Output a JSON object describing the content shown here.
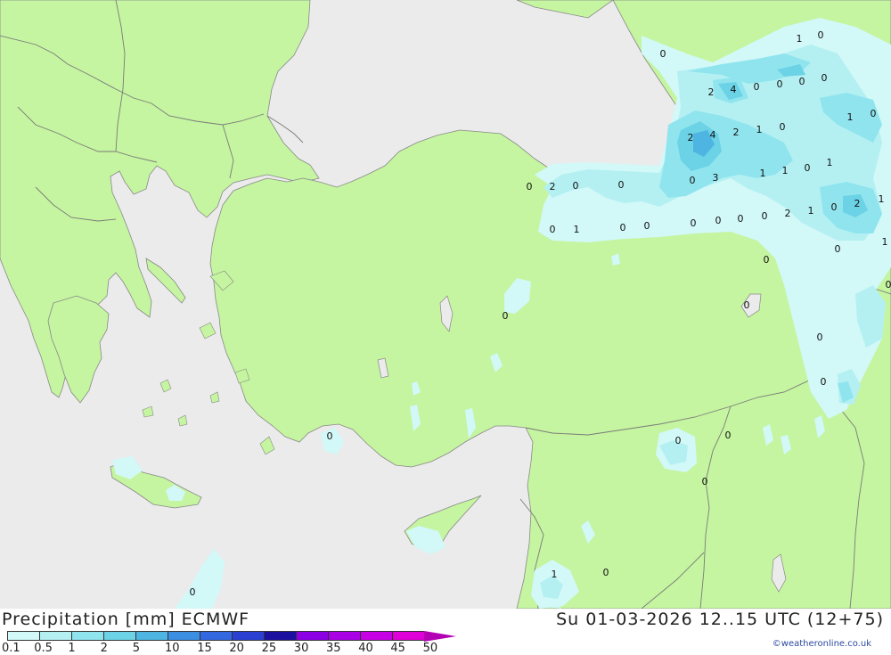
{
  "title": "Precipitation [mm] ECMWF",
  "datetime": "Su 01-03-2026 12..15 UTC (12+75)",
  "credit": "©weatheronline.co.uk",
  "colors": {
    "sea": "#ebebeb",
    "land": "#c5f5a0",
    "border": "#7a7a7a",
    "coast": "#888888"
  },
  "legend": {
    "ticks": [
      "0.1",
      "0.5",
      "1",
      "2",
      "5",
      "10",
      "15",
      "20",
      "25",
      "30",
      "35",
      "40",
      "45",
      "50"
    ],
    "colors": [
      "#d2f8f8",
      "#b4f0f2",
      "#90e4ee",
      "#6cd2e6",
      "#4eb4e2",
      "#3c8ee2",
      "#3468e0",
      "#2a40d2",
      "#1c10a0",
      "#8c00e6",
      "#aa00e6",
      "#c800e6",
      "#e000d8",
      "#b400b4"
    ]
  },
  "precip_values": [
    {
      "t": "1"
    },
    {
      "t": "0"
    },
    {
      "t": "0"
    },
    {
      "t": "2"
    },
    {
      "t": "4"
    },
    {
      "t": "0"
    },
    {
      "t": "0"
    },
    {
      "t": "0"
    },
    {
      "t": "0"
    },
    {
      "t": "1"
    },
    {
      "t": "0"
    },
    {
      "t": "2"
    },
    {
      "t": "4"
    },
    {
      "t": "2"
    },
    {
      "t": "1"
    },
    {
      "t": "0"
    },
    {
      "t": "0"
    },
    {
      "t": "2"
    },
    {
      "t": "0"
    },
    {
      "t": "0"
    },
    {
      "t": "3"
    },
    {
      "t": "1"
    },
    {
      "t": "1"
    },
    {
      "t": "0"
    },
    {
      "t": "1"
    },
    {
      "t": "0"
    },
    {
      "t": "0"
    },
    {
      "t": "1"
    },
    {
      "t": "0"
    },
    {
      "t": "0"
    },
    {
      "t": "0"
    },
    {
      "t": "0"
    },
    {
      "t": "0"
    },
    {
      "t": "0"
    },
    {
      "t": "2"
    },
    {
      "t": "1"
    },
    {
      "t": "0"
    },
    {
      "t": "2"
    },
    {
      "t": "1"
    },
    {
      "t": "0"
    },
    {
      "t": "0"
    },
    {
      "t": "1"
    },
    {
      "t": "0"
    },
    {
      "t": "0"
    },
    {
      "t": "0"
    },
    {
      "t": "0"
    },
    {
      "t": "0"
    },
    {
      "t": "0"
    },
    {
      "t": "0"
    },
    {
      "t": "0"
    },
    {
      "t": "0"
    },
    {
      "t": "1"
    },
    {
      "t": "0"
    },
    {
      "t": "0"
    }
  ]
}
